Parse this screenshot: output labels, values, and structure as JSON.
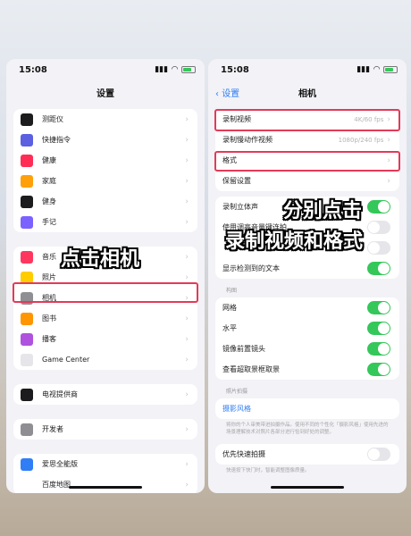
{
  "left_phone": {
    "status_time": "15:08",
    "nav_title": "设置",
    "group1": [
      {
        "label": "测距仪",
        "icon": "ruler-icon",
        "color": "#1c1c1e"
      },
      {
        "label": "快捷指令",
        "icon": "shortcuts-icon",
        "color": "#5b5fe0"
      },
      {
        "label": "健康",
        "icon": "heart-icon",
        "color": "#ff2d55"
      },
      {
        "label": "家庭",
        "icon": "home-icon",
        "color": "#ff9f0a"
      },
      {
        "label": "健身",
        "icon": "fitness-icon",
        "color": "#1c1c1e"
      },
      {
        "label": "手记",
        "icon": "journal-icon",
        "color": "#7b61ff"
      }
    ],
    "group2": [
      {
        "label": "音乐",
        "icon": "music-icon",
        "color": "#ff375f"
      },
      {
        "label": "照片",
        "icon": "photos-icon",
        "color": "#ffcc00"
      },
      {
        "label": "相机",
        "icon": "camera-icon",
        "color": "#8e8e93"
      },
      {
        "label": "图书",
        "icon": "books-icon",
        "color": "#ff9500"
      },
      {
        "label": "播客",
        "icon": "podcast-icon",
        "color": "#af52de"
      },
      {
        "label": "Game Center",
        "icon": "game-center-icon",
        "color": "#e5e5ea"
      }
    ],
    "group3": [
      {
        "label": "电视提供商",
        "icon": "tv-provider-icon",
        "color": "#1c1c1e"
      }
    ],
    "group4": [
      {
        "label": "开发者",
        "icon": "developer-icon",
        "color": "#8e8e93"
      }
    ],
    "group5": [
      {
        "label": "爱思全能版",
        "icon": "app-icon",
        "color": "#2f7ef6"
      },
      {
        "label": "百度地图",
        "icon": "map-icon",
        "color": "#ffffff"
      }
    ]
  },
  "right_phone": {
    "status_time": "15:08",
    "back_label": "设置",
    "nav_title": "相机",
    "group1": [
      {
        "label": "录制视频",
        "value": "4K/60 fps"
      },
      {
        "label": "录制慢动作视频",
        "value": "1080p/240 fps"
      },
      {
        "label": "格式",
        "value": ""
      },
      {
        "label": "保留设置",
        "value": ""
      }
    ],
    "group2": [
      {
        "label": "录制立体声",
        "on": true
      },
      {
        "label": "使用调高音量键连拍",
        "on": false
      },
      {
        "label": "",
        "on": false
      },
      {
        "label": "显示检测到的文本",
        "on": true
      }
    ],
    "compose_head": "构图",
    "group3": [
      {
        "label": "网格",
        "on": true
      },
      {
        "label": "水平",
        "on": true
      },
      {
        "label": "镜像前置镜头",
        "on": true
      },
      {
        "label": "查看超取景框取景",
        "on": true
      }
    ],
    "photo_head": "照片拍摄",
    "photo_style_link": "摄影风格",
    "photo_style_note": "将你的个人审美带进拍摄作品。使用不同的个性化「摄影风格」使用先进的场景理解技术对照片各部分进行恰到好处的调整。",
    "group4": [
      {
        "label": "优先快速拍摄",
        "on": false
      }
    ],
    "quick_note": "快速按下快门时，智能调整图像质量。"
  },
  "overlays": {
    "left_text": "点击相机",
    "right_line1": "分别点击",
    "right_line2": "录制视频和格式"
  }
}
